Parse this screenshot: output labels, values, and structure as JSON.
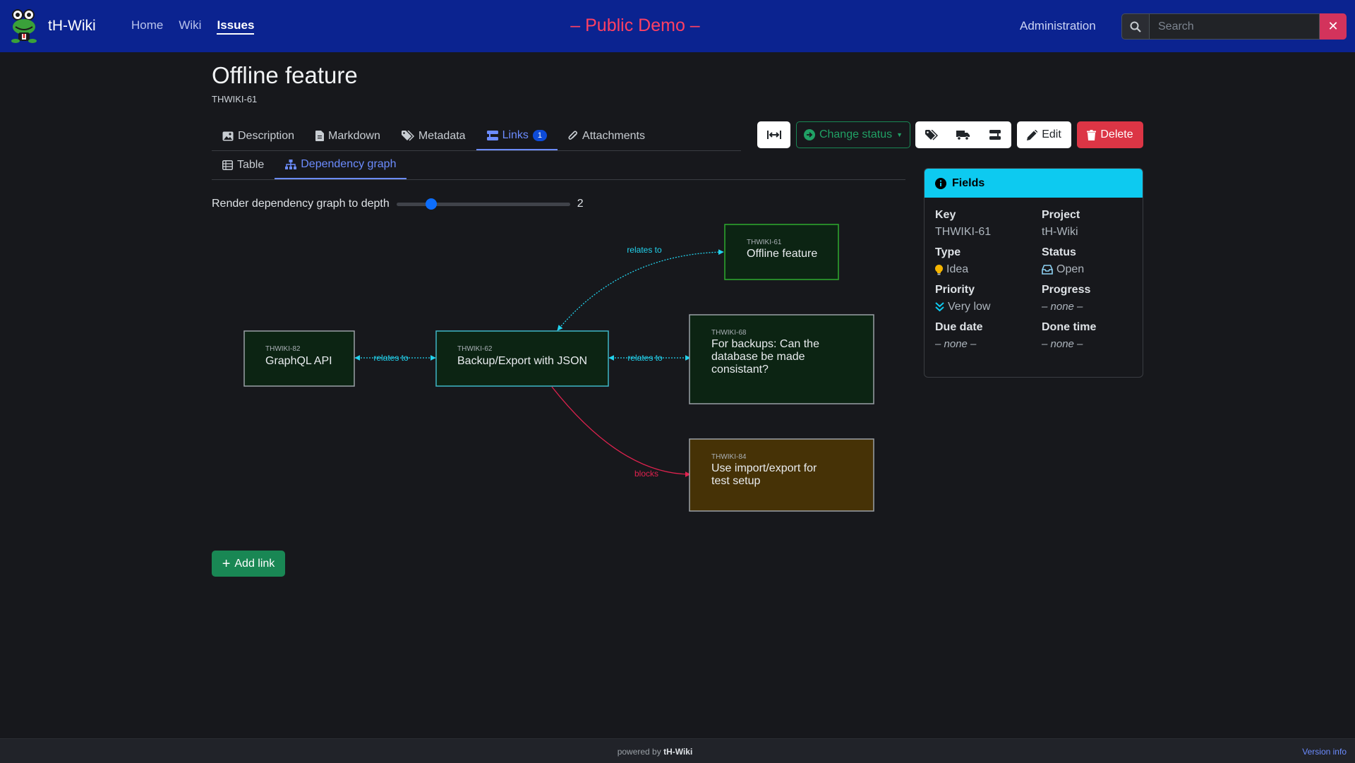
{
  "brand": {
    "name": "tH-Wiki"
  },
  "nav": {
    "home": "Home",
    "wiki": "Wiki",
    "issues": "Issues"
  },
  "banner": "– Public Demo –",
  "admin": "Administration",
  "search": {
    "placeholder": "Search"
  },
  "issue": {
    "title": "Offline feature",
    "key": "THWIKI-61"
  },
  "tabs": {
    "description": "Description",
    "markdown": "Markdown",
    "metadata": "Metadata",
    "links": "Links",
    "links_count": "1",
    "attachments": "Attachments"
  },
  "subtabs": {
    "table": "Table",
    "graph": "Dependency graph"
  },
  "toolbar": {
    "change_status": "Change status",
    "edit": "Edit",
    "delete": "Delete"
  },
  "depth": {
    "label": "Render dependency graph to depth",
    "value": "2",
    "level": 2,
    "min": 1,
    "max": 10
  },
  "graph": {
    "nodes": [
      {
        "key": "THWIKI-61",
        "title": "Offline feature",
        "fill": "#0c2413",
        "stroke": "#2eab2e"
      },
      {
        "key": "THWIKI-82",
        "title": "GraphQL API",
        "fill": "#0c2413",
        "stroke": "#9aa0a6"
      },
      {
        "key": "THWIKI-62",
        "title": "Backup/Export with JSON",
        "fill": "#0c2413",
        "stroke": "#3fb6c8"
      },
      {
        "key": "THWIKI-68",
        "title": "For backups: Can the database be made consistant?",
        "fill": "#0c2413",
        "stroke": "#9aa0a6"
      },
      {
        "key": "THWIKI-84",
        "title": "Use import/export for test setup",
        "fill": "#463206",
        "stroke": "#9aa0a6"
      }
    ],
    "edges": [
      {
        "label": "relates to",
        "color": "#22d3ee"
      },
      {
        "label": "relates to",
        "color": "#22d3ee"
      },
      {
        "label": "relates to",
        "color": "#22d3ee"
      },
      {
        "label": "blocks",
        "color": "#e0224f"
      }
    ]
  },
  "add_link": "Add link",
  "fields": {
    "header": "Fields",
    "key_label": "Key",
    "key_value": "THWIKI-61",
    "project_label": "Project",
    "project_value": "tH-Wiki",
    "type_label": "Type",
    "type_value": "Idea",
    "status_label": "Status",
    "status_value": "Open",
    "priority_label": "Priority",
    "priority_value": "Very low",
    "progress_label": "Progress",
    "progress_value": "– none –",
    "due_label": "Due date",
    "due_value": "– none –",
    "done_label": "Done time",
    "done_value": "– none –"
  },
  "footer": {
    "powered": "powered by",
    "brand": "tH-Wiki",
    "version": "Version info"
  },
  "colors": {
    "navbar": "#0b2390",
    "banner": "#ff4063",
    "accent": "#6c8cff",
    "danger": "#dc3545",
    "success": "#198754",
    "info": "#0dcaf0"
  }
}
